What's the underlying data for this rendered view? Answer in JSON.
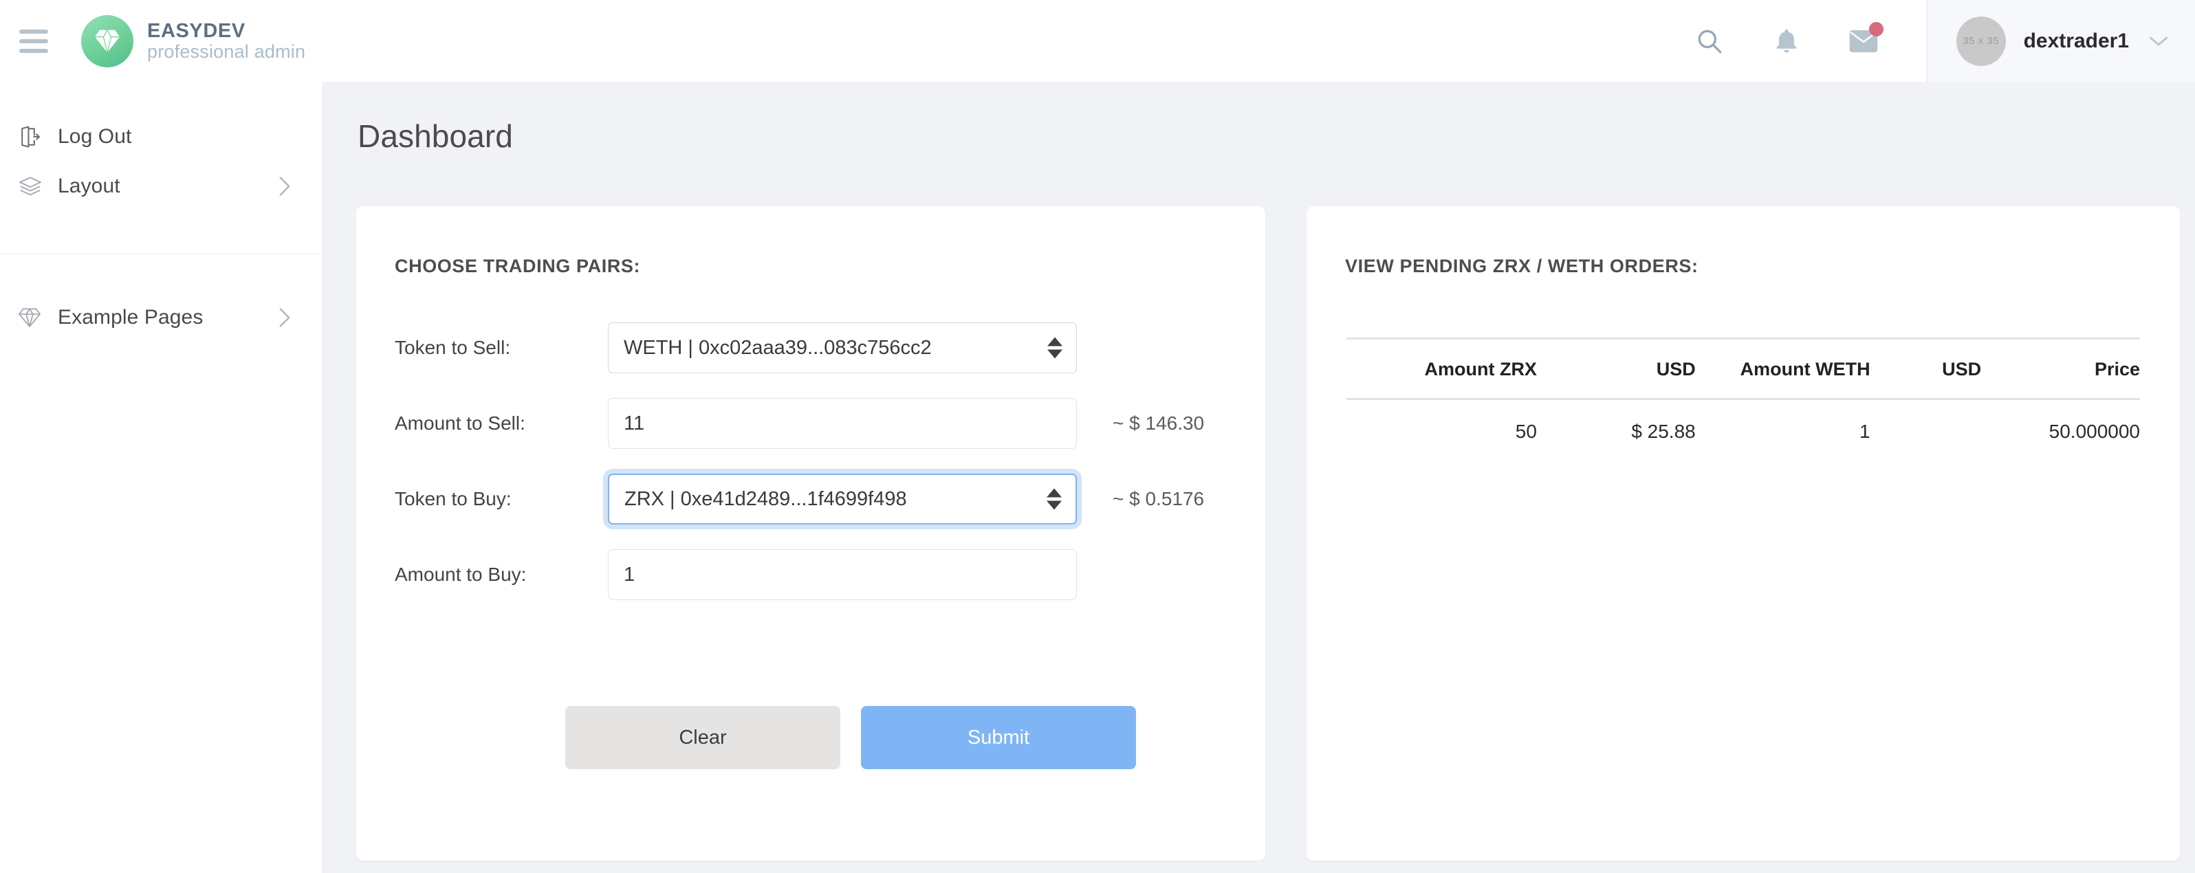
{
  "header": {
    "menu_icon": "hamburger-icon",
    "brand_name": "EASYDEV",
    "brand_subtitle": "professional admin",
    "logo_icon": "diamond-icon",
    "search_icon": "search-icon",
    "notifications_icon": "bell-icon",
    "mail_icon": "mail-icon",
    "mail_badge": "",
    "avatar_text": "35 x 35",
    "user_name": "dextrader1",
    "caret_icon": "chevron-down-icon"
  },
  "sidebar": {
    "items": [
      {
        "label": "Log Out",
        "icon": "logout-icon",
        "has_chevron": false
      },
      {
        "label": "Layout",
        "icon": "layers-icon",
        "has_chevron": true
      },
      {
        "label": "Example Pages",
        "icon": "diamond-icon",
        "has_chevron": true
      }
    ]
  },
  "main": {
    "page_title": "Dashboard",
    "trade_card": {
      "heading": "CHOOSE TRADING PAIRS:",
      "fields": [
        {
          "label": "Token to Sell:",
          "value": "WETH | 0xc02aaa39...083c756cc2",
          "type": "select",
          "hint": "",
          "focused": false
        },
        {
          "label": "Amount to Sell:",
          "value": "11",
          "type": "text",
          "hint": "~ $ 146.30",
          "focused": false
        },
        {
          "label": "Token to Buy:",
          "value": "ZRX | 0xe41d2489...1f4699f498",
          "type": "select",
          "hint": "~ $ 0.5176",
          "focused": true
        },
        {
          "label": "Amount to Buy:",
          "value": "1",
          "type": "text",
          "hint": "",
          "focused": false
        }
      ],
      "clear_label": "Clear",
      "submit_label": "Submit"
    },
    "orders_card": {
      "heading": "VIEW PENDING ZRX / WETH ORDERS:",
      "columns": [
        "Amount ZRX",
        "USD",
        "Amount WETH",
        "USD",
        "Price"
      ],
      "rows": [
        [
          "50",
          "$ 25.88",
          "1",
          "",
          "50.000000"
        ]
      ]
    }
  },
  "colors": {
    "accent_blue": "#80b5f5",
    "brand_green": "#6fcf97",
    "badge_red": "#d66b7e",
    "page_bg": "#f1f2f6"
  }
}
